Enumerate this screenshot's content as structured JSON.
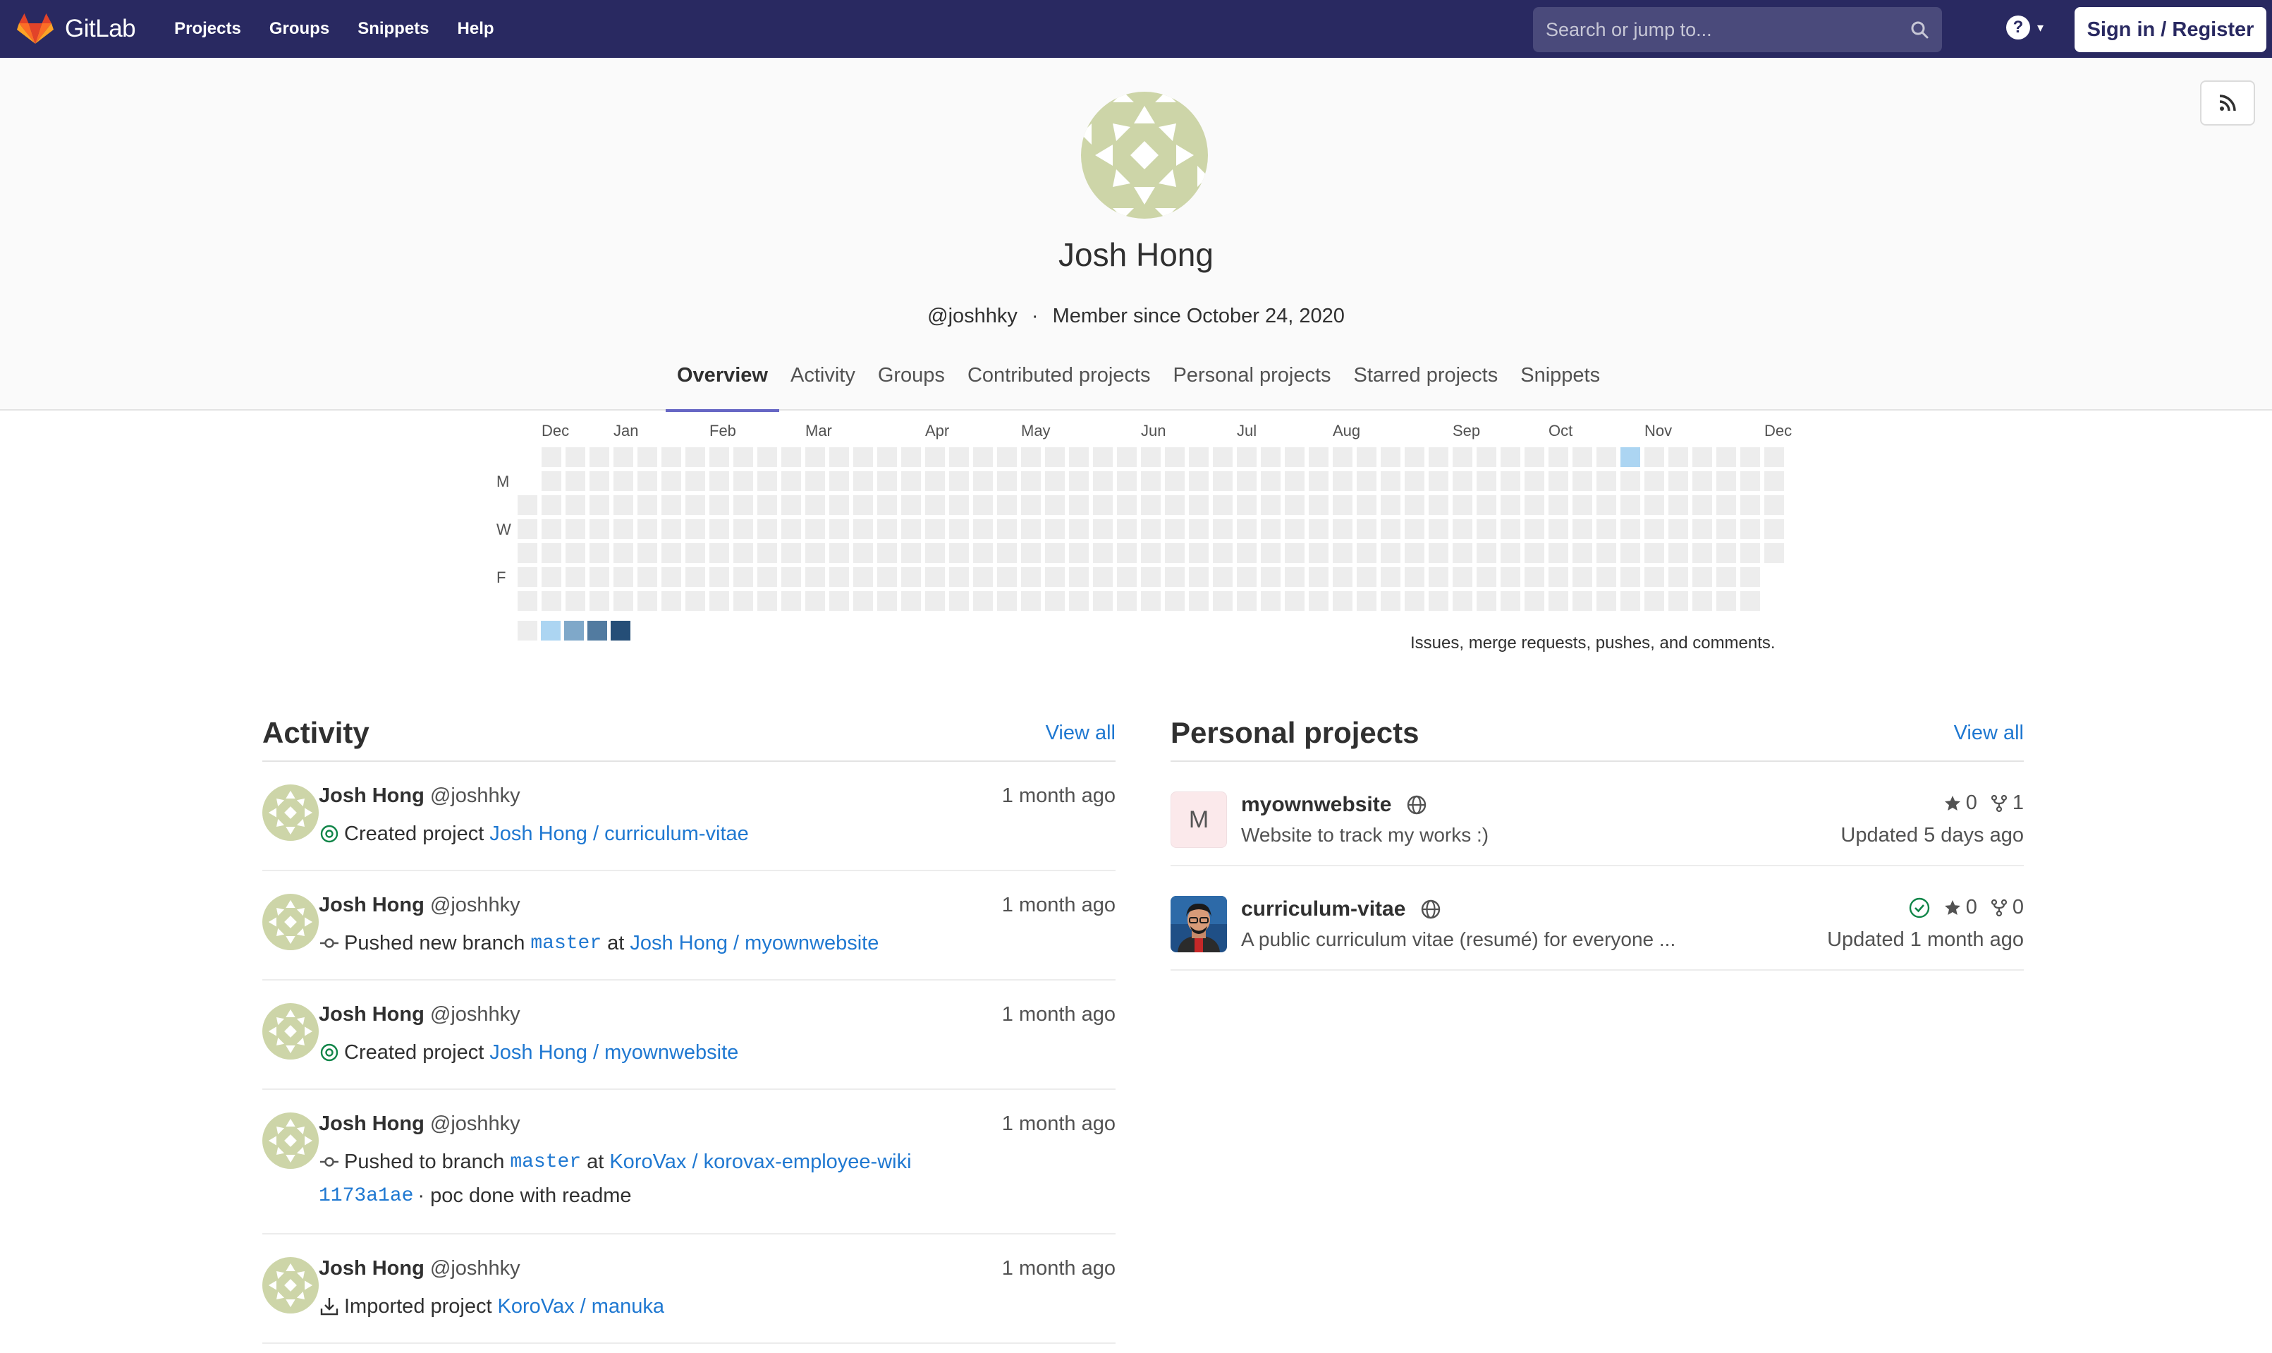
{
  "nav": {
    "brand": "GitLab",
    "links": [
      "Projects",
      "Groups",
      "Snippets",
      "Help"
    ],
    "search_placeholder": "Search or jump to...",
    "help_label": "?",
    "signin_label": "Sign in / Register"
  },
  "profile": {
    "name": "Josh Hong",
    "handle": "@joshhky",
    "dot": "·",
    "member_since": "Member since October 24, 2020",
    "tabs": [
      "Overview",
      "Activity",
      "Groups",
      "Contributed projects",
      "Personal projects",
      "Starred projects",
      "Snippets"
    ],
    "active_tab": "Overview"
  },
  "calendar": {
    "months": [
      "Dec",
      "Jan",
      "Feb",
      "Mar",
      "Apr",
      "May",
      "Jun",
      "Jul",
      "Aug",
      "Sep",
      "Oct",
      "Nov",
      "Dec"
    ],
    "day_labels": [
      "M",
      "W",
      "F"
    ],
    "legend_text": "Issues, merge requests, pushes, and comments.",
    "legend_colors": [
      "#ededed",
      "#acd5f2",
      "#7fa8c9",
      "#527ba0",
      "#254e77"
    ],
    "empty_color": "#ededed",
    "weeks": 53,
    "active_cells": [
      {
        "week": 46,
        "day": 0,
        "level": 1
      }
    ]
  },
  "activity": {
    "title": "Activity",
    "view_all": "View all",
    "events": [
      {
        "name": "Josh Hong",
        "handle": "@joshhky",
        "time": "1 month ago",
        "icon": "created-icon",
        "text": "Created project",
        "link": "Josh Hong / curriculum-vitae"
      },
      {
        "name": "Josh Hong",
        "handle": "@joshhky",
        "time": "1 month ago",
        "icon": "commit-icon",
        "text": "Pushed new branch",
        "branch": "master",
        "at": "at",
        "link": "Josh Hong / myownwebsite"
      },
      {
        "name": "Josh Hong",
        "handle": "@joshhky",
        "time": "1 month ago",
        "icon": "created-icon",
        "text": "Created project",
        "link": "Josh Hong / myownwebsite"
      },
      {
        "name": "Josh Hong",
        "handle": "@joshhky",
        "time": "1 month ago",
        "icon": "commit-icon",
        "text": "Pushed to branch",
        "branch": "master",
        "at": "at",
        "link": "KoroVax / korovax-employee-wiki",
        "commit_sha": "1173a1ae",
        "commit_msg": "· poc done with readme"
      },
      {
        "name": "Josh Hong",
        "handle": "@joshhky",
        "time": "1 month ago",
        "icon": "import-icon",
        "text": "Imported project",
        "link": "KoroVax / manuka"
      }
    ]
  },
  "projects": {
    "title": "Personal projects",
    "view_all": "View all",
    "items": [
      {
        "avatar_letter": "M",
        "name": "myownwebsite",
        "description": "Website to track my works :)",
        "stars": "0",
        "forks": "1",
        "updated": "Updated 5 days ago",
        "pipeline_passed": false
      },
      {
        "avatar_letter": "",
        "name": "curriculum-vitae",
        "description": "A public curriculum vitae (resumé) for everyone ...",
        "stars": "0",
        "forks": "0",
        "updated": "Updated 1 month ago",
        "pipeline_passed": true
      }
    ]
  }
}
